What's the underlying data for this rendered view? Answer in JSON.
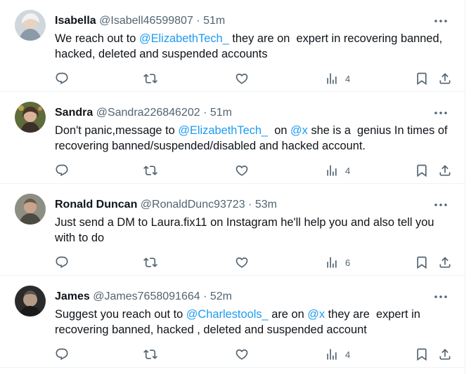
{
  "colors": {
    "accent": "#1d9bf0",
    "text": "#0f1419",
    "secondary": "#536471",
    "divider": "#eff3f4"
  },
  "tweets": [
    {
      "name": "Isabella",
      "handle": "@Isabell46599807",
      "dot": "·",
      "time": "51m",
      "text": {
        "a": "We reach out to ",
        "m1": "@ElizabethTech_",
        "b": " they are on  expert in recovering banned, hacked, deleted and suspended accounts",
        "m2": "",
        "c": ""
      },
      "views": "4"
    },
    {
      "name": "Sandra",
      "handle": "@Sandra226846202",
      "dot": "·",
      "time": "51m",
      "text": {
        "a": "Don't panic,message to ",
        "m1": "@ElizabethTech_",
        "b": "  on ",
        "m2": "@x",
        "c": " she is a  genius In times of recovering banned/suspended/disabled and hacked account."
      },
      "views": "4"
    },
    {
      "name": "Ronald Duncan",
      "handle": "@RonaldDunc93723",
      "dot": "·",
      "time": "53m",
      "text": {
        "a": "Just send a DM to Laura.fix11 on Instagram he'll help you and also tell you with to do",
        "m1": "",
        "b": "",
        "m2": "",
        "c": ""
      },
      "views": "6"
    },
    {
      "name": "James",
      "handle": "@James7658091664",
      "dot": "·",
      "time": "52m",
      "text": {
        "a": "Suggest you reach out to ",
        "m1": "@Charlestools_",
        "b": " are on ",
        "m2": "@x",
        "c": " they are  expert in recovering banned, hacked , deleted and suspended account"
      },
      "views": "4"
    }
  ]
}
